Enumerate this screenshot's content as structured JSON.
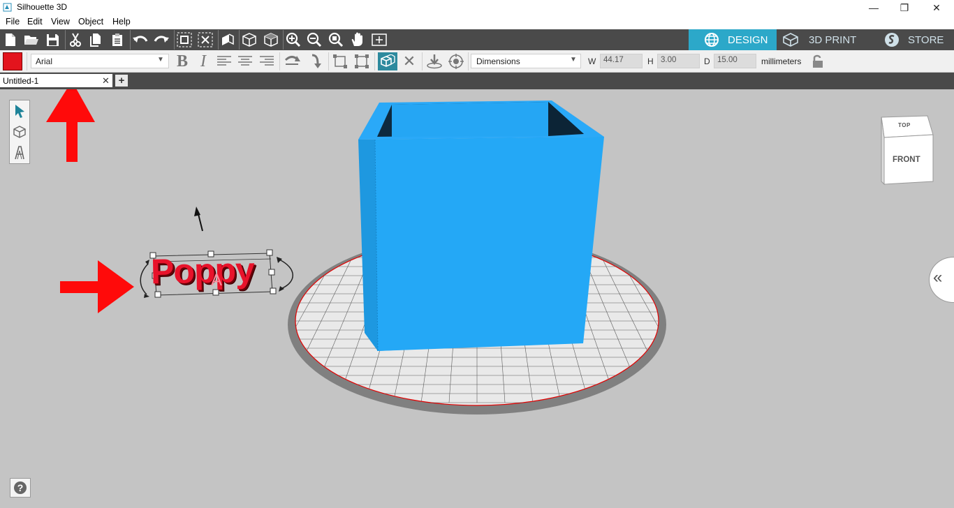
{
  "window": {
    "title": "Silhouette 3D",
    "minimize": "—",
    "maximize": "❐",
    "close": "✕"
  },
  "menu": [
    "File",
    "Edit",
    "View",
    "Object",
    "Help"
  ],
  "modes": {
    "design": "DESIGN",
    "print": "3D PRINT",
    "store": "STORE",
    "active": "design"
  },
  "text_toolbar": {
    "color": "#e3141d",
    "font": "Arial",
    "dimensions_mode": "Dimensions",
    "w_label": "W",
    "w_value": "44.17",
    "h_label": "H",
    "h_value": "3.00",
    "d_label": "D",
    "d_value": "15.00",
    "units": "millimeters"
  },
  "document_tab": {
    "title": "Untitled-1",
    "close": "✕",
    "new": "+"
  },
  "view_cube": {
    "top": "TOP",
    "front": "FRONT"
  },
  "canvas": {
    "text_object": "Poppy",
    "box_color": "#22a7f5",
    "annotation_arrow_color": "#ff0a0a"
  },
  "side_panel_toggle": "«",
  "help": "?"
}
